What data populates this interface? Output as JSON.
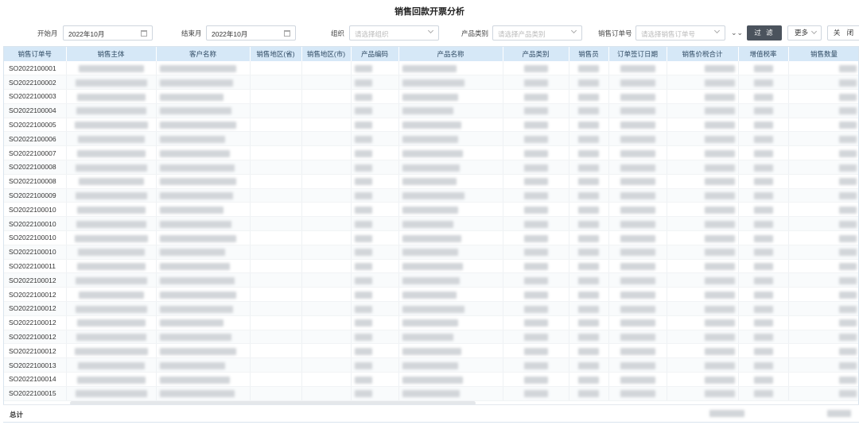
{
  "page": {
    "title": "销售回款开票分析"
  },
  "filters": {
    "start_month_label": "开始月",
    "start_month_value": "2022年10月",
    "end_month_label": "结束月",
    "end_month_value": "2022年10月",
    "org_label": "组织",
    "org_placeholder": "请选择组织",
    "product_category_label": "产品类别",
    "product_category_placeholder": "请选择产品类别",
    "sales_order_label": "销售订单号",
    "sales_order_placeholder": "请选择销售订单号",
    "expand_icon": "double-chevron-down-icon",
    "filter_button": "过 滤",
    "more_button": "更多",
    "close_button": "关 闭"
  },
  "table": {
    "columns": [
      "销售订单号",
      "销售主体",
      "客户名称",
      "销售地区(省)",
      "销售地区(市)",
      "产品编码",
      "产品名称",
      "产品类别",
      "销售员",
      "订单签订日期",
      "销售价税合计",
      "增值税率",
      "销售数量"
    ],
    "rows": [
      "SO2022100001",
      "SO2022100002",
      "SO2022100003",
      "SO2022100004",
      "SO2022100005",
      "SO2022100006",
      "SO2022100007",
      "SO2022100008",
      "SO2022100008",
      "SO2022100009",
      "SO2022100010",
      "SO2022100010",
      "SO2022100010",
      "SO2022100010",
      "SO2022100011",
      "SO2022100012",
      "SO2022100012",
      "SO2022100012",
      "SO2022100012",
      "SO2022100012",
      "SO2022100012",
      "SO2022100013",
      "SO2022100014",
      "SO2022100015"
    ],
    "total_label": "总计"
  },
  "colors": {
    "header_bg": "#d6e8f7",
    "filter_button_bg": "#4b535d"
  }
}
